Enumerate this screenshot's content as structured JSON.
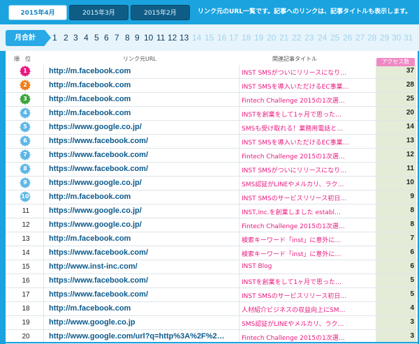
{
  "header": {
    "month_tabs": [
      {
        "label": "2015年4月",
        "active": true
      },
      {
        "label": "2015年3月",
        "active": false
      },
      {
        "label": "2015年2月",
        "active": false
      }
    ],
    "note": "リンク元のURL一覧です。記事へのリンクは、記事タイトルも表示します。"
  },
  "daybar": {
    "total_label": "月合計",
    "days": [
      "1",
      "2",
      "3",
      "4",
      "5",
      "6",
      "7",
      "8",
      "9",
      "10",
      "11",
      "12",
      "13",
      "14",
      "15",
      "16",
      "17",
      "18",
      "19",
      "20",
      "21",
      "22",
      "23",
      "24",
      "25",
      "26",
      "27",
      "28",
      "29",
      "30",
      "31"
    ],
    "active_through": 13
  },
  "table": {
    "headers": {
      "rank": "順　位",
      "url": "リンク元URL",
      "title": "関連記事タイトル",
      "count": "アクセス数"
    },
    "rows": [
      {
        "rank": "1",
        "badge": true,
        "badge_color": "#e8177f",
        "url": "http://m.facebook.com",
        "title": "INST SMSがついにリリースになり…",
        "count": "37"
      },
      {
        "rank": "2",
        "badge": true,
        "badge_color": "#ee7f1a",
        "url": "http://m.facebook.com",
        "title": "INST SMSを導入いただけるEC事業…",
        "count": "28"
      },
      {
        "rank": "3",
        "badge": true,
        "badge_color": "#3aa43a",
        "url": "http://m.facebook.com",
        "title": "Fintech Challenge 2015の1次選…",
        "count": "25"
      },
      {
        "rank": "4",
        "badge": true,
        "badge_color": "#5db7e6",
        "url": "http://m.facebook.com",
        "title": "INSTを創業をして1ヶ月で思った…",
        "count": "20"
      },
      {
        "rank": "5",
        "badge": true,
        "badge_color": "#5db7e6",
        "url": "https://www.google.co.jp/",
        "title": "SMSも受け取れる！業務用電話と…",
        "count": "14"
      },
      {
        "rank": "6",
        "badge": true,
        "badge_color": "#5db7e6",
        "url": "https://www.facebook.com/",
        "title": "INST SMSを導入いただけるEC事業…",
        "count": "13"
      },
      {
        "rank": "7",
        "badge": true,
        "badge_color": "#5db7e6",
        "url": "https://www.facebook.com/",
        "title": "Fintech Challenge 2015の1次選…",
        "count": "12"
      },
      {
        "rank": "8",
        "badge": true,
        "badge_color": "#5db7e6",
        "url": "https://www.facebook.com/",
        "title": "INST SMSがついにリリースになり…",
        "count": "11"
      },
      {
        "rank": "9",
        "badge": true,
        "badge_color": "#5db7e6",
        "url": "https://www.google.co.jp/",
        "title": "SMS認証がLINEやメルカリ、ラク…",
        "count": "10"
      },
      {
        "rank": "10",
        "badge": true,
        "badge_color": "#5db7e6",
        "url": "http://m.facebook.com",
        "title": "INST SMSのサービスリリース初日…",
        "count": "9"
      },
      {
        "rank": "11",
        "badge": false,
        "url": "https://www.google.co.jp/",
        "title": "INST,Inc.を創業しました establ…",
        "count": "8"
      },
      {
        "rank": "12",
        "badge": false,
        "url": "https://www.google.co.jp/",
        "title": "Fintech Challenge 2015の1次選…",
        "count": "8"
      },
      {
        "rank": "13",
        "badge": false,
        "url": "http://m.facebook.com",
        "title": "検索キーワード「inst」に意外に…",
        "count": "7"
      },
      {
        "rank": "14",
        "badge": false,
        "url": "https://www.facebook.com/",
        "title": "検索キーワード「inst」に意外に…",
        "count": "6"
      },
      {
        "rank": "15",
        "badge": false,
        "url": "http://www.inst-inc.com/",
        "title": "INST Blog",
        "count": "6"
      },
      {
        "rank": "16",
        "badge": false,
        "url": "https://www.facebook.com/",
        "title": "INSTを創業をして1ヶ月で思った…",
        "count": "5"
      },
      {
        "rank": "17",
        "badge": false,
        "url": "https://www.facebook.com/",
        "title": "INST SMSのサービスリリース初日…",
        "count": "5"
      },
      {
        "rank": "18",
        "badge": false,
        "url": "http://m.facebook.com",
        "title": "人材紹介ビジネスの収益向上にSM…",
        "count": "4"
      },
      {
        "rank": "19",
        "badge": false,
        "url": "http://www.google.co.jp",
        "title": "SMS認証がLINEやメルカリ、ラク…",
        "count": "3"
      },
      {
        "rank": "20",
        "badge": false,
        "url": "http://www.google.com/url?q=http%3A%2F%2…",
        "title": "Fintech Challenge 2015の1次選…",
        "count": "3"
      }
    ]
  }
}
